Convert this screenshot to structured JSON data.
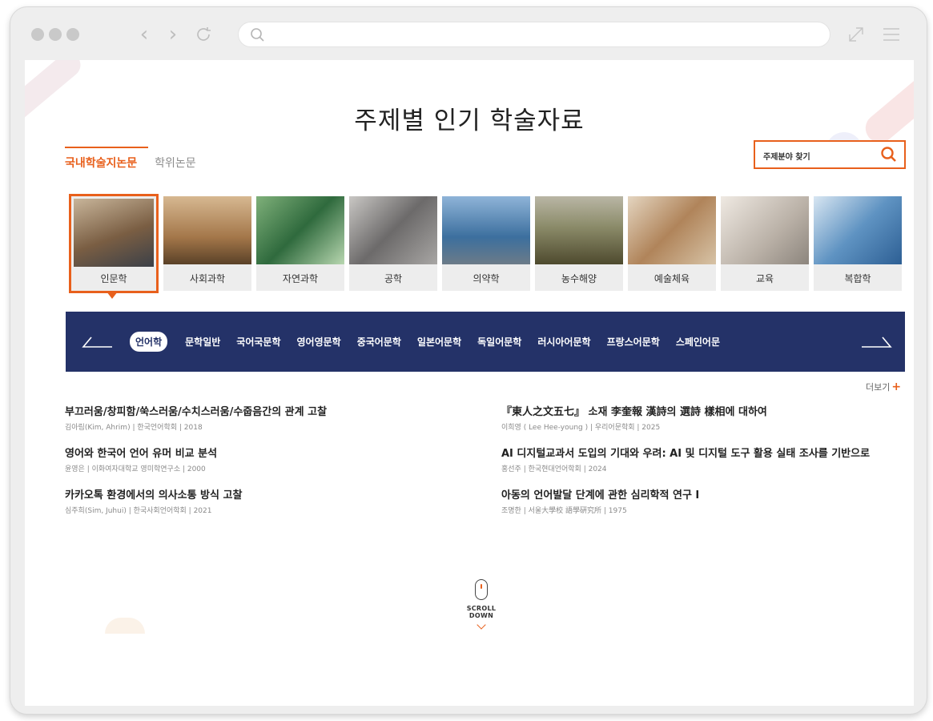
{
  "page": {
    "title": "주제별 인기 학술자료",
    "tabs": [
      {
        "label": "국내학술지논문",
        "active": true
      },
      {
        "label": "학위논문",
        "active": false
      }
    ],
    "subject_search": {
      "label": "주제분야 찾기",
      "icon": "search-icon"
    },
    "categories": [
      {
        "label": "인문학",
        "selected": true,
        "color": "#9a7a5a"
      },
      {
        "label": "사회과학",
        "selected": false,
        "color": "#b88a56"
      },
      {
        "label": "자연과학",
        "selected": false,
        "color": "#3f7a4c"
      },
      {
        "label": "공학",
        "selected": false,
        "color": "#8a8a92"
      },
      {
        "label": "의약학",
        "selected": false,
        "color": "#5f88b6"
      },
      {
        "label": "농수해양",
        "selected": false,
        "color": "#6f7f5a"
      },
      {
        "label": "예술체육",
        "selected": false,
        "color": "#b69a7a"
      },
      {
        "label": "교육",
        "selected": false,
        "color": "#c9c3bb"
      },
      {
        "label": "복합학",
        "selected": false,
        "color": "#6c9cc6"
      }
    ],
    "subcategories": [
      {
        "label": "언어학",
        "active": true
      },
      {
        "label": "문학일반",
        "active": false
      },
      {
        "label": "국어국문학",
        "active": false
      },
      {
        "label": "영어영문학",
        "active": false
      },
      {
        "label": "중국어문학",
        "active": false
      },
      {
        "label": "일본어문학",
        "active": false
      },
      {
        "label": "독일어문학",
        "active": false
      },
      {
        "label": "러시아어문학",
        "active": false
      },
      {
        "label": "프랑스어문학",
        "active": false
      },
      {
        "label": "스페인어문",
        "active": false
      }
    ],
    "more_label": "더보기",
    "more_plus": "+",
    "papers": [
      {
        "title": "부끄러움/창피함/쑥스러움/수치스러움/수줍음간의 관계 고찰",
        "meta": "김아림(Kim, Ahrim) | 한국언어학회 | 2018"
      },
      {
        "title": "『東人之文五七』 소재 李奎報 漢詩의 選詩 樣相에 대하여",
        "meta": "이희영 ( Lee Hee-young ) | 우리어문학회 | 2025"
      },
      {
        "title": "영어와 한국어 언어 유머 비교 분석",
        "meta": "윤영은 | 이화여자대학교 영미학연구소 | 2000"
      },
      {
        "title": "AI 디지털교과서 도입의 기대와 우려: AI 및 디지털 도구 활용 실태 조사를 기반으로",
        "meta": "홍선주 | 한국현대언어학회 | 2024"
      },
      {
        "title": "카카오톡 환경에서의 의사소통 방식 고찰",
        "meta": "심주희(Sim, Juhui) | 한국사회언어학회 | 2021"
      },
      {
        "title": "아동의 언어발달 단계에 관한 심리학적 연구 Ⅰ",
        "meta": "조명한 | 서울大學校 語學硏究所 | 1975"
      }
    ],
    "scroll_label": "SCROLL DOWN"
  },
  "colors": {
    "accent": "#e8601c",
    "navy": "#243268"
  }
}
